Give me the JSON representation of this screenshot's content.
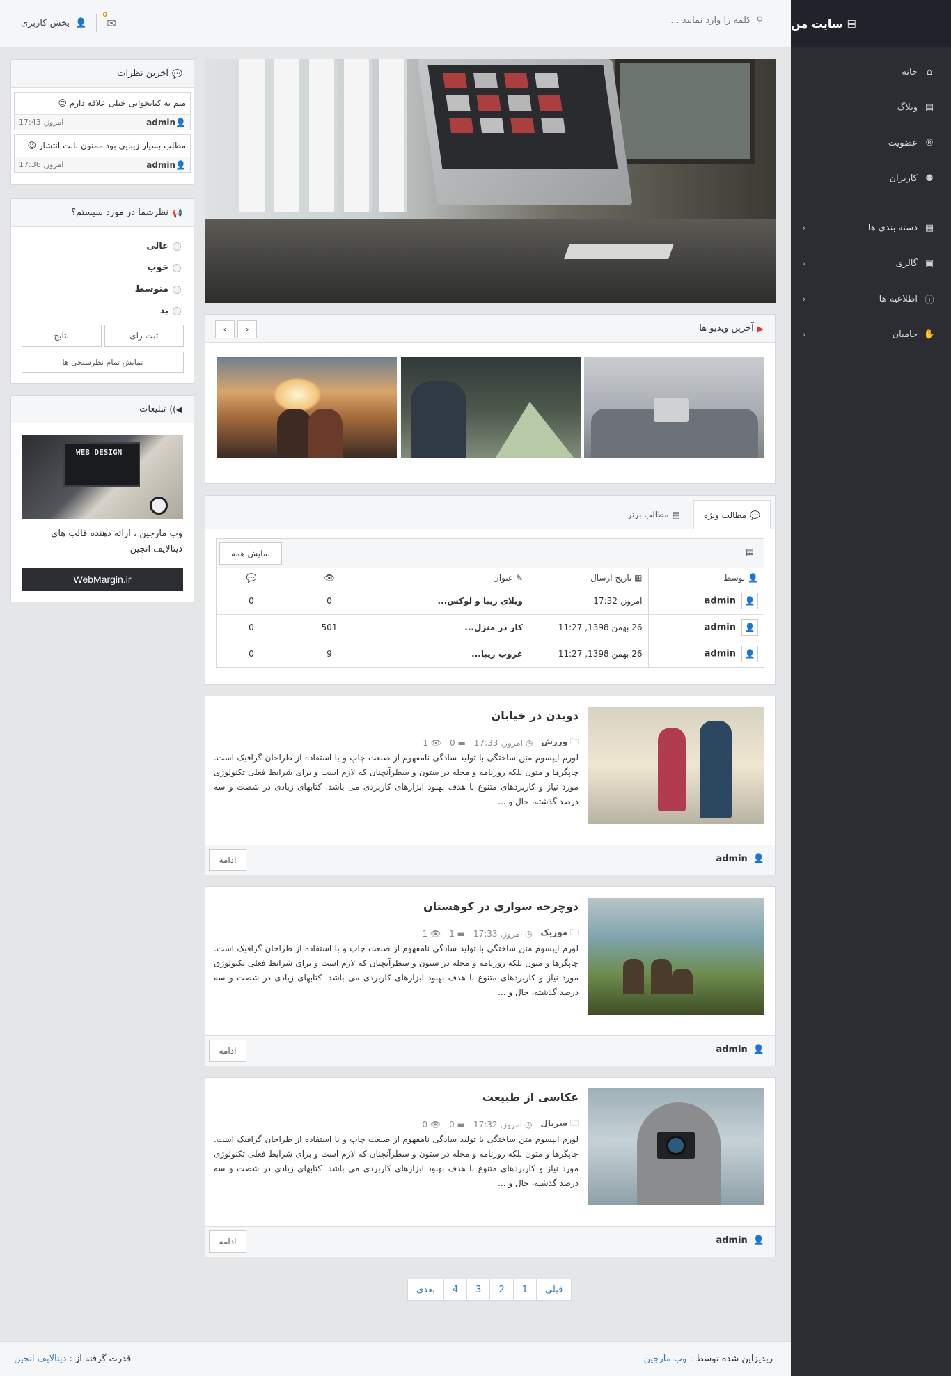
{
  "sidebar": {
    "brand": "سایت من",
    "items": [
      {
        "label": "خانه",
        "icon": "home-icon",
        "glyph": "⌂"
      },
      {
        "label": "وبلاگ",
        "icon": "document-icon",
        "glyph": "▤"
      },
      {
        "label": "عضویت",
        "icon": "registered-icon",
        "glyph": "®"
      },
      {
        "label": "کاربران",
        "icon": "users-icon",
        "glyph": "👥"
      },
      {
        "label": "دسته بندی ها",
        "icon": "grid-icon",
        "glyph": "▦"
      },
      {
        "label": "گالری",
        "icon": "image-icon",
        "glyph": "▣"
      },
      {
        "label": "اطلاعیه ها",
        "icon": "info-icon",
        "glyph": "ⓘ"
      },
      {
        "label": "حامیان",
        "icon": "handshake-icon",
        "glyph": "✋"
      }
    ]
  },
  "topbar": {
    "search_placeholder": "کلمه را وارد نمایید ...",
    "messages_count": "0",
    "user_label": "بخش کاربری"
  },
  "comments": {
    "title": "آخرین نظرات",
    "items": [
      {
        "text": "منم به کتابخوانی خیلی علاقه دارم 😍",
        "author": "admin",
        "time": "امروز, 17:43"
      },
      {
        "text": "مطلب بسیار زیبایی بود ممنون بابت انتشار 😉",
        "author": "admin",
        "time": "امروز, 17:36"
      }
    ]
  },
  "poll": {
    "title": "نظرشما در مورد سیستم؟",
    "options": [
      "عالی",
      "خوب",
      "متوسط",
      "بد"
    ],
    "vote_label": "ثبت رای",
    "results_label": "نتایج",
    "all_label": "نمایش تمام نظرسنجی ها"
  },
  "ads": {
    "title": "تبلیغات",
    "image_text": "WEB DESIGN",
    "text": "وب مارجین ، ارائه دهنده قالب های دیتالایف انجین",
    "button": "WebMargin.ir"
  },
  "videos": {
    "title": "آخرین ویدیو ها",
    "prev": "‹",
    "next": "›"
  },
  "featured": {
    "tab_active": "مطالب ویژه",
    "tab_other": "مطالب برتر",
    "show_all": "نمایش همه",
    "columns": {
      "author": "توسط",
      "date": "تاریخ ارسال",
      "title": "عنوان"
    },
    "rows": [
      {
        "author": "admin",
        "date": "امروز, 17:32",
        "title": "ویلای زیبا و لوکس...",
        "views": "0",
        "comments": "0"
      },
      {
        "author": "admin",
        "date": "26 بهمن 1398, 11:27",
        "title": "کار در منزل...",
        "views": "501",
        "comments": "0"
      },
      {
        "author": "admin",
        "date": "26 بهمن 1398, 11:27",
        "title": "غروب زیبا...",
        "views": "9",
        "comments": "0"
      }
    ]
  },
  "posts": [
    {
      "title": "دویدن در خیابان",
      "category": "ورزش",
      "time": "امروز, 17:33",
      "comments": "0",
      "views": "1",
      "body": "لورم ایپسوم متن ساختگی با تولید سادگی نامفهوم از صنعت چاپ و با استفاده از طراحان گرافیک است. چاپگرها و متون بلکه روزنامه و مجله در ستون و سطرآنچنان که لازم است و برای شرایط فعلی تکنولوژی مورد نیاز و کاربردهای متنوع با هدف بهبود ابزارهای کاربردی می باشد. کتابهای زیادی در شصت و سه درصد گذشته، حال و ...",
      "author": "admin",
      "more": "ادامه"
    },
    {
      "title": "دوچرخه سواری در کوهستان",
      "category": "موزیک",
      "time": "امروز, 17:33",
      "comments": "1",
      "views": "1",
      "body": "لورم ایپسوم متن ساختگی با تولید سادگی نامفهوم از صنعت چاپ و با استفاده از طراحان گرافیک است. چاپگرها و متون بلکه روزنامه و مجله در ستون و سطرآنچنان که لازم است و برای شرایط فعلی تکنولوژی مورد نیاز و کاربردهای متنوع با هدف بهبود ابزارهای کاربردی می باشد. کتابهای زیادی در شصت و سه درصد گذشته، حال و ...",
      "author": "admin",
      "more": "ادامه"
    },
    {
      "title": "عکاسی از طبیعت",
      "category": "سریال",
      "time": "امروز, 17:32",
      "comments": "0",
      "views": "0",
      "body": "لورم ایپسوم متن ساختگی با تولید سادگی نامفهوم از صنعت چاپ و با استفاده از طراحان گرافیک است. چاپگرها و متون بلکه روزنامه و مجله در ستون و سطرآنچنان که لازم است و برای شرایط فعلی تکنولوژی مورد نیاز و کاربردهای متنوع با هدف بهبود ابزارهای کاربردی می باشد. کتابهای زیادی در شصت و سه درصد گذشته، حال و ...",
      "author": "admin",
      "more": "ادامه"
    }
  ],
  "pager": {
    "prev": "قبلی",
    "pages": [
      "1",
      "2",
      "3",
      "4"
    ],
    "next": "بعدی"
  },
  "footer": {
    "redesign_prefix": "ریدیزاین شده توسط :",
    "redesign_link": "وب مارجین",
    "powered_prefix": "قدرت گرفته از :",
    "powered_link": "دیتالایف انجین"
  }
}
